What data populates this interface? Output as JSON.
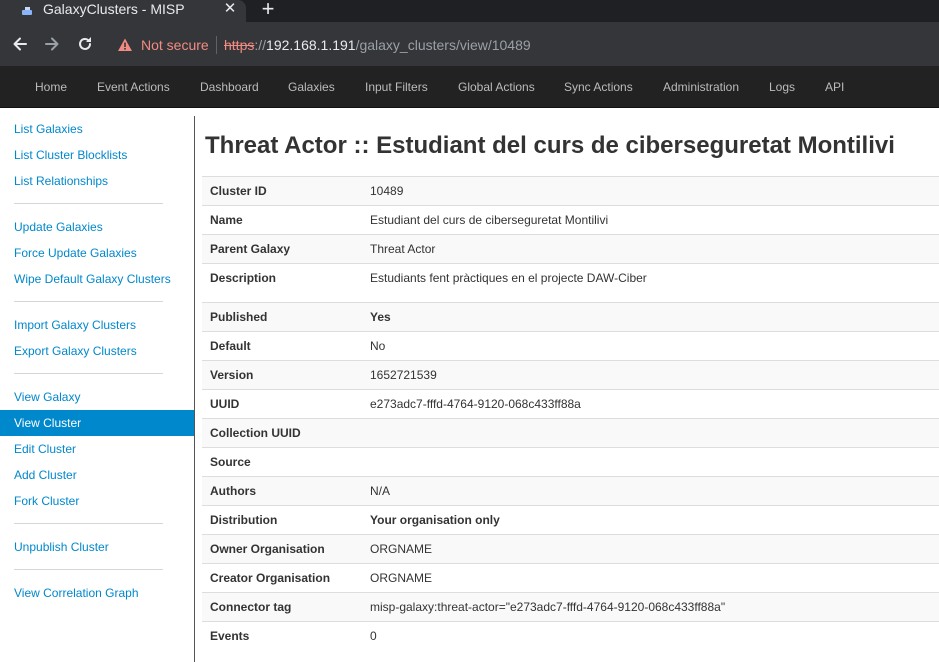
{
  "browser": {
    "tab_title": "GalaxyClusters - MISP",
    "tab_close": "✕",
    "new_tab": "+",
    "not_secure": "Not secure",
    "url_scheme": "https",
    "url_sep": "://",
    "url_host": "192.168.1.191",
    "url_path": "/galaxy_clusters/view/10489",
    "colors": {
      "tab_bg": "#35363a",
      "strip_bg": "#1f2023",
      "warn": "#f28b82"
    }
  },
  "navbar": {
    "items": [
      "Home",
      "Event Actions",
      "Dashboard",
      "Galaxies",
      "Input Filters",
      "Global Actions",
      "Sync Actions",
      "Administration",
      "Logs",
      "API"
    ]
  },
  "sidebar": {
    "items": [
      "List Galaxies",
      "List Cluster Blocklists",
      "List Relationships",
      "Update Galaxies",
      "Force Update Galaxies",
      "Wipe Default Galaxy Clusters",
      "Import Galaxy Clusters",
      "Export Galaxy Clusters",
      "View Galaxy",
      "View Cluster",
      "Edit Cluster",
      "Add Cluster",
      "Fork Cluster",
      "Unpublish Cluster",
      "View Correlation Graph"
    ],
    "active": "View Cluster",
    "accent": "#0088cc"
  },
  "main": {
    "title": "Threat Actor :: Estudiant del curs de ciberseguretat Montilivi",
    "rows": [
      {
        "key": "Cluster ID",
        "value": "10489"
      },
      {
        "key": "Name",
        "value": "Estudiant del curs de ciberseguretat Montilivi"
      },
      {
        "key": "Parent Galaxy",
        "value": "Threat Actor"
      },
      {
        "key": "Description",
        "value": "Estudiants fent pràctiques en el projecte DAW-Ciber"
      },
      {
        "key": "Published",
        "value": "Yes"
      },
      {
        "key": "Default",
        "value": "No"
      },
      {
        "key": "Version",
        "value": "1652721539"
      },
      {
        "key": "UUID",
        "value": "e273adc7-fffd-4764-9120-068c433ff88a"
      },
      {
        "key": "Collection UUID",
        "value": ""
      },
      {
        "key": "Source",
        "value": ""
      },
      {
        "key": "Authors",
        "value": "N/A"
      },
      {
        "key": "Distribution",
        "value": "Your organisation only"
      },
      {
        "key": "Owner Organisation",
        "value": "ORGNAME"
      },
      {
        "key": "Creator Organisation",
        "value": "ORGNAME"
      },
      {
        "key": "Connector tag",
        "value": "misp-galaxy:threat-actor=\"e273adc7-fffd-4764-9120-068c433ff88a\""
      },
      {
        "key": "Events",
        "value": "0"
      }
    ],
    "colors": {
      "published_yes": "#008000",
      "distribution": "#e00000",
      "link": "#0088cc"
    }
  }
}
